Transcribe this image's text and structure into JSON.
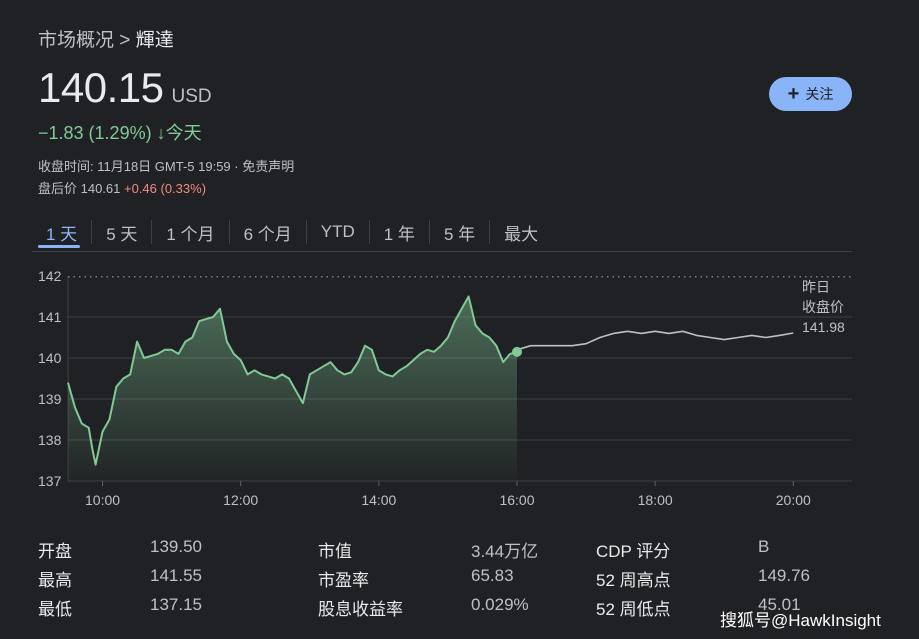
{
  "breadcrumb": {
    "parent": "市场概况",
    "sep": ">",
    "current": "輝達"
  },
  "quote": {
    "price": "140.15",
    "currency": "USD",
    "change": "−1.83 (1.29%)",
    "change_arrow": "↓",
    "change_period": "今天"
  },
  "close_info": {
    "label": "收盘时间: 11月18日 GMT-5 19:59",
    "sep": "·",
    "disclaimer": "免责声明"
  },
  "after_hours": {
    "label": "盘后价 140.61",
    "change": "+0.46 (0.33%)"
  },
  "follow_button": {
    "icon": "plus-icon",
    "label": "关注"
  },
  "range_tabs": [
    "1 天",
    "5 天",
    "1 个月",
    "6 个月",
    "YTD",
    "1 年",
    "5 年",
    "最大"
  ],
  "active_tab": "1 天",
  "colors": {
    "up_accent": "#81c995",
    "down_accent": "#f28b82",
    "link": "#8ab4f8",
    "background": "#202124",
    "post_market_line": "#bdc1c6"
  },
  "chart_data": {
    "type": "line",
    "ylim": [
      137,
      142
    ],
    "yticks": [
      142,
      141,
      140,
      139,
      138,
      137
    ],
    "xlim": [
      9.5,
      20.85
    ],
    "xticks": [
      10,
      12,
      14,
      16,
      18,
      20
    ],
    "xtick_labels": [
      "10:00",
      "12:00",
      "14:00",
      "16:00",
      "18:00",
      "20:00"
    ],
    "previous_close": {
      "value": 141.98,
      "label_line1": "昨日",
      "label_line2": "收盘价",
      "value_label": "141.98"
    },
    "grid": true,
    "series": [
      {
        "x": [
          9.5,
          9.6,
          9.7,
          9.8,
          9.85,
          9.9,
          10.0,
          10.1,
          10.2,
          10.3,
          10.4,
          10.5,
          10.6,
          10.7,
          10.8,
          10.9,
          11.0,
          11.1,
          11.2,
          11.3,
          11.4,
          11.5,
          11.6,
          11.7,
          11.8,
          11.9,
          12.0,
          12.1,
          12.2,
          12.3,
          12.4,
          12.5,
          12.6,
          12.7,
          12.8,
          12.9,
          13.0,
          13.1,
          13.2,
          13.3,
          13.4,
          13.5,
          13.6,
          13.7,
          13.8,
          13.9,
          14.0,
          14.1,
          14.2,
          14.3,
          14.4,
          14.5,
          14.6,
          14.7,
          14.8,
          14.9,
          15.0,
          15.1,
          15.2,
          15.3,
          15.4,
          15.5,
          15.6,
          15.7,
          15.8,
          15.9,
          16.0
        ],
        "y": [
          139.4,
          138.8,
          138.4,
          138.3,
          137.8,
          137.4,
          138.2,
          138.5,
          139.3,
          139.5,
          139.6,
          140.4,
          140.0,
          140.05,
          140.1,
          140.2,
          140.2,
          140.1,
          140.4,
          140.5,
          140.9,
          140.95,
          141.0,
          141.2,
          140.4,
          140.1,
          139.95,
          139.6,
          139.7,
          139.6,
          139.55,
          139.5,
          139.6,
          139.5,
          139.2,
          138.9,
          139.6,
          139.7,
          139.8,
          139.9,
          139.7,
          139.6,
          139.65,
          139.9,
          140.3,
          140.2,
          139.7,
          139.6,
          139.55,
          139.7,
          139.8,
          139.95,
          140.1,
          140.2,
          140.15,
          140.3,
          140.5,
          140.9,
          141.2,
          141.5,
          140.8,
          140.6,
          140.5,
          140.3,
          139.9,
          140.1,
          140.15
        ]
      },
      {
        "x": [
          16.0,
          16.2,
          16.4,
          16.6,
          16.8,
          17.0,
          17.2,
          17.4,
          17.6,
          17.8,
          18.0,
          18.2,
          18.4,
          18.6,
          18.8,
          19.0,
          19.2,
          19.4,
          19.6,
          19.8,
          20.0
        ],
        "y": [
          140.2,
          140.3,
          140.3,
          140.3,
          140.3,
          140.35,
          140.5,
          140.6,
          140.65,
          140.6,
          140.65,
          140.6,
          140.65,
          140.55,
          140.5,
          140.45,
          140.5,
          140.55,
          140.5,
          140.55,
          140.61
        ]
      }
    ]
  },
  "stats": [
    {
      "label": "开盘",
      "value": "139.50"
    },
    {
      "label": "最高",
      "value": "141.55"
    },
    {
      "label": "最低",
      "value": "137.15"
    },
    {
      "label": "市值",
      "value": "3.44万亿"
    },
    {
      "label": "市盈率",
      "value": "65.83"
    },
    {
      "label": "股息收益率",
      "value": "0.029%"
    },
    {
      "label": "CDP 评分",
      "value": "B"
    },
    {
      "label": "52 周高点",
      "value": "149.76"
    },
    {
      "label": "52 周低点",
      "value": "45.01"
    }
  ],
  "watermark": "搜狐号@HawkInsight"
}
